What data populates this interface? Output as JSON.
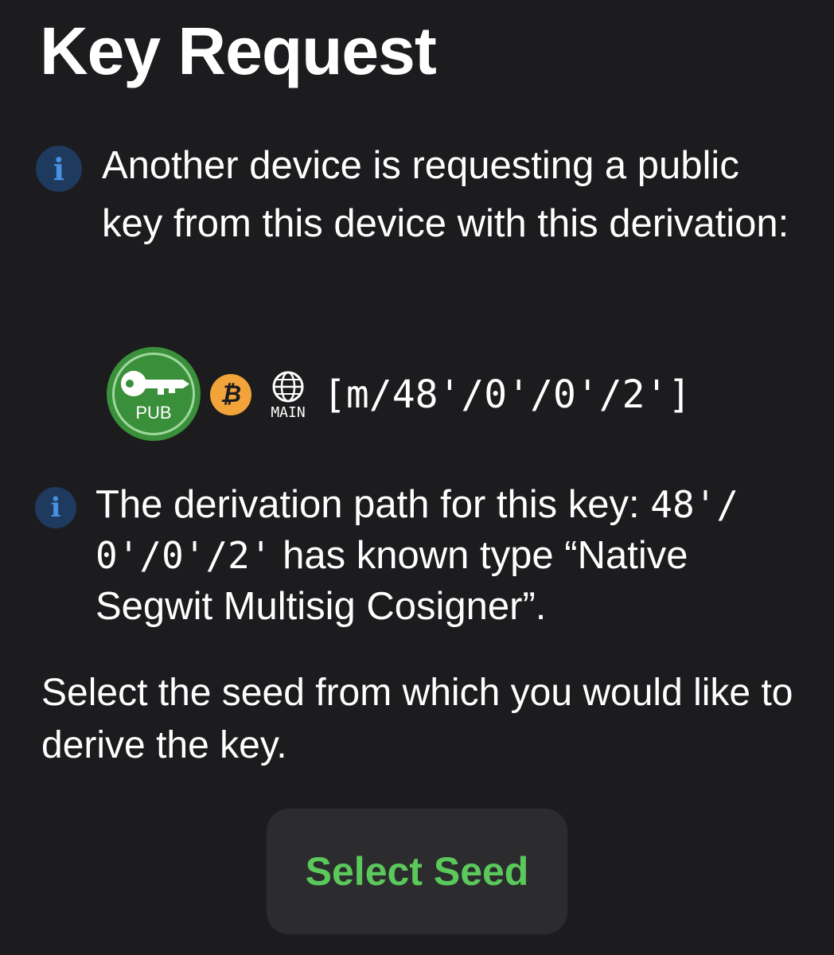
{
  "page": {
    "title": "Key Request"
  },
  "request_info": {
    "icon": "info-icon",
    "text": "Another device is requesting a public key from this device with this derivation:"
  },
  "derivation": {
    "badge_label": "PUB",
    "badge_icon": "key-icon",
    "badge_color": "#3a8f3a",
    "coin_icon": "bitcoin-icon",
    "coin_symbol": "₿",
    "coin_color": "#f2a33a",
    "network_icon": "globe-icon",
    "network_label": "MAIN",
    "path": "[m/48'/0'/0'/2']"
  },
  "type_note": {
    "icon": "info-icon",
    "prefix": "The derivation path for this key: ",
    "path_part1": "48'/",
    "path_part2": "0'/0'/2'",
    "suffix_1": " has known type “Native",
    "suffix_2": "Segwit Multisig Cosigner”."
  },
  "instruction": "Select the seed from which you would like to derive the key.",
  "actions": {
    "select_seed_label": "Select Seed",
    "accent_color": "#5ac85a"
  }
}
